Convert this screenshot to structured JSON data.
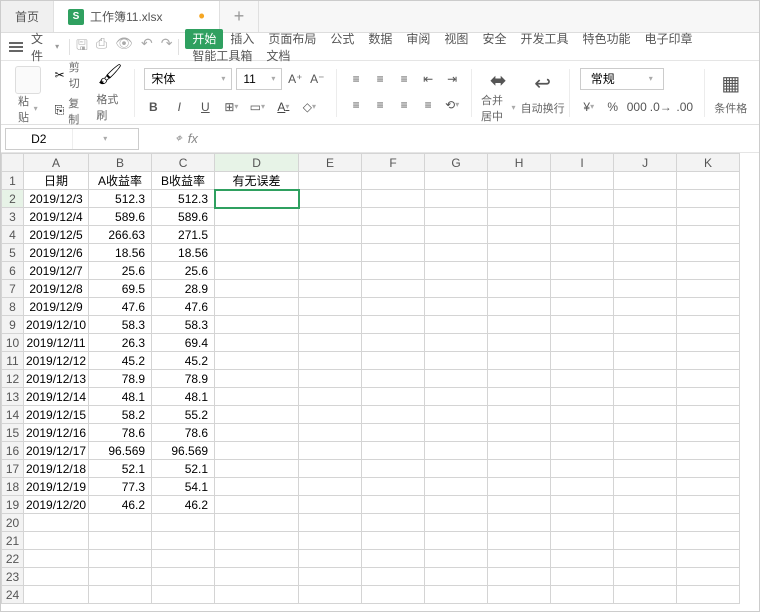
{
  "tabs": {
    "home": "首页",
    "file": "工作簿11.xlsx",
    "doc_glyph": "S"
  },
  "menubar": {
    "file": "文件",
    "items": [
      "开始",
      "插入",
      "页面布局",
      "公式",
      "数据",
      "审阅",
      "视图",
      "安全",
      "开发工具",
      "特色功能",
      "电子印章",
      "智能工具箱",
      "文档"
    ]
  },
  "ribbon": {
    "cut": "剪切",
    "copy": "复制",
    "format_painter": "格式刷",
    "paste": "粘贴",
    "font": "宋体",
    "size": "11",
    "merge": "合并居中",
    "wrap": "自动换行",
    "number_fmt": "常规",
    "cond_fmt": "条件格"
  },
  "namebox": "D2",
  "columns": [
    "A",
    "B",
    "C",
    "D",
    "E",
    "F",
    "G",
    "H",
    "I",
    "J",
    "K"
  ],
  "headers": {
    "A": "日期",
    "B": "A收益率",
    "C": "B收益率",
    "D": "有无误差"
  },
  "rows": [
    {
      "A": "2019/12/3",
      "B": "512.3",
      "C": "512.3"
    },
    {
      "A": "2019/12/4",
      "B": "589.6",
      "C": "589.6"
    },
    {
      "A": "2019/12/5",
      "B": "266.63",
      "C": "271.5"
    },
    {
      "A": "2019/12/6",
      "B": "18.56",
      "C": "18.56"
    },
    {
      "A": "2019/12/7",
      "B": "25.6",
      "C": "25.6"
    },
    {
      "A": "2019/12/8",
      "B": "69.5",
      "C": "28.9"
    },
    {
      "A": "2019/12/9",
      "B": "47.6",
      "C": "47.6"
    },
    {
      "A": "2019/12/10",
      "B": "58.3",
      "C": "58.3"
    },
    {
      "A": "2019/12/11",
      "B": "26.3",
      "C": "69.4"
    },
    {
      "A": "2019/12/12",
      "B": "45.2",
      "C": "45.2"
    },
    {
      "A": "2019/12/13",
      "B": "78.9",
      "C": "78.9"
    },
    {
      "A": "2019/12/14",
      "B": "48.1",
      "C": "48.1"
    },
    {
      "A": "2019/12/15",
      "B": "58.2",
      "C": "55.2"
    },
    {
      "A": "2019/12/16",
      "B": "78.6",
      "C": "78.6"
    },
    {
      "A": "2019/12/17",
      "B": "96.569",
      "C": "96.569"
    },
    {
      "A": "2019/12/18",
      "B": "52.1",
      "C": "52.1"
    },
    {
      "A": "2019/12/19",
      "B": "77.3",
      "C": "54.1"
    },
    {
      "A": "2019/12/20",
      "B": "46.2",
      "C": "46.2"
    }
  ],
  "total_rows": 24,
  "active": {
    "col": "D",
    "row": 2
  }
}
